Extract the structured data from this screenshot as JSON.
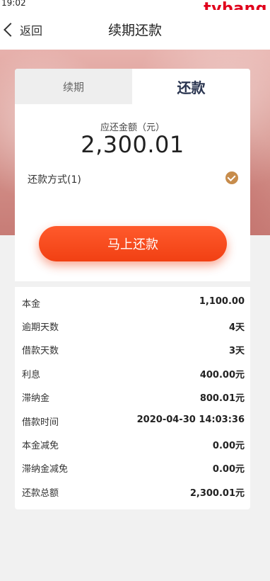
{
  "status_bar": {
    "time": "19:02",
    "watermark": "tvbang"
  },
  "nav": {
    "back_label": "返回",
    "title": "续期还款"
  },
  "tabs": [
    {
      "label": "续期",
      "active": false
    },
    {
      "label": "还款",
      "active": true
    }
  ],
  "amount": {
    "label": "应还金额（元）",
    "value": "2,300.01"
  },
  "payment_method": {
    "label": "还款方式(1)",
    "checked": true
  },
  "pay_button": {
    "label": "马上还款"
  },
  "details": [
    {
      "label": "本金",
      "value": "1,100.00"
    },
    {
      "label": "逾期天数",
      "value": "4天"
    },
    {
      "label": "借款天数",
      "value": "3天"
    },
    {
      "label": "利息",
      "value": "400.00元"
    },
    {
      "label": "滞纳金",
      "value": "800.01元"
    },
    {
      "label": "借款时间",
      "value": "2020-04-30 14:03:36"
    },
    {
      "label": "本金减免",
      "value": "0.00元"
    },
    {
      "label": "滞纳金减免",
      "value": "0.00元"
    },
    {
      "label": "还款总额",
      "value": "2,300.01元"
    }
  ],
  "colors": {
    "accent": "#f14013",
    "tab_active_text": "#2a3550",
    "check": "#c78c4c",
    "watermark": "#e0001b"
  }
}
